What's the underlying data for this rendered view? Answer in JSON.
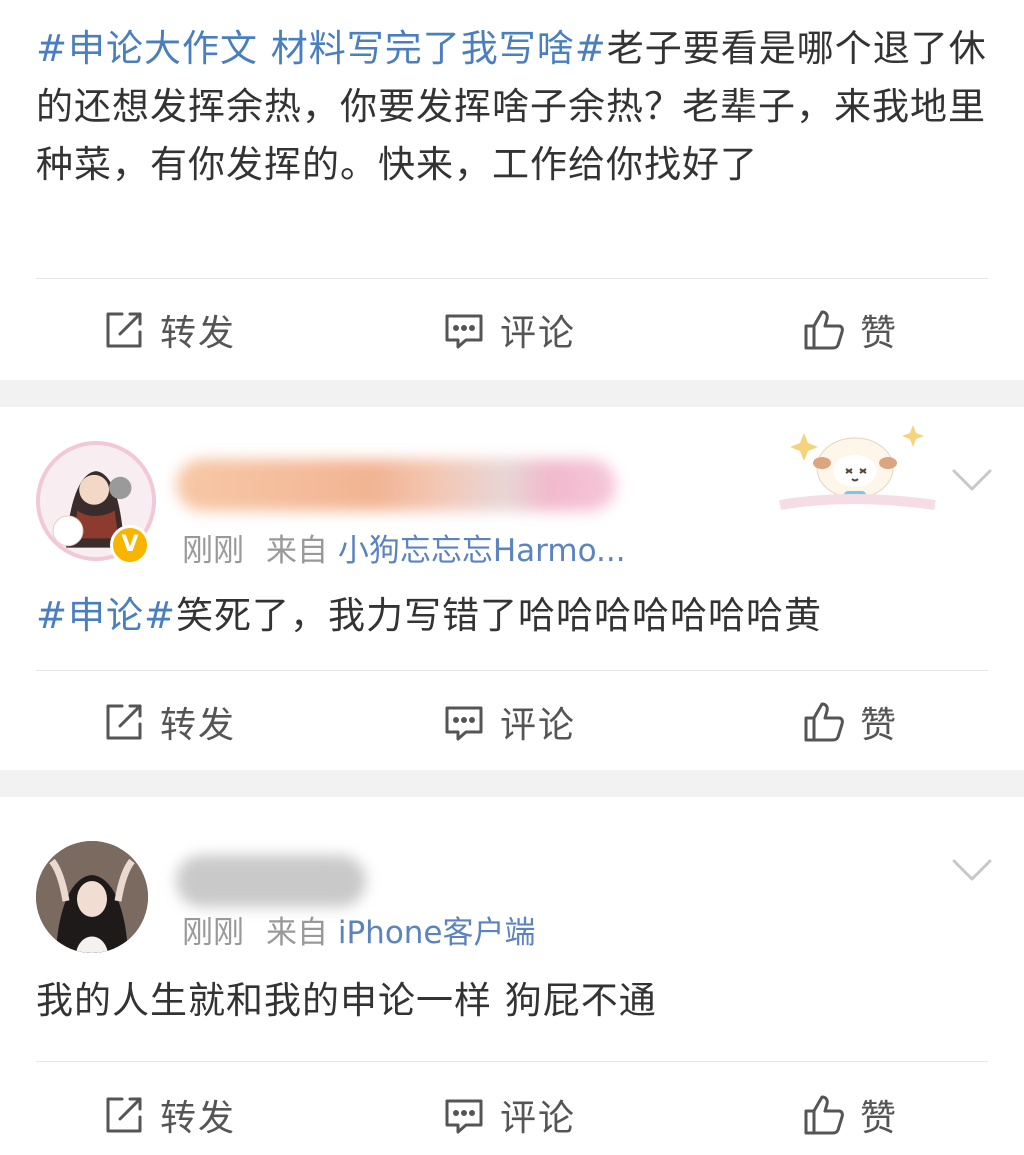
{
  "posts": [
    {
      "topic": "#申论大作文 材料写完了我写啥#",
      "text": "老子要看是哪个退了休的还想发挥余热，你要发挥啥子余热？老辈子，来我地里种菜，有你发挥的。快来，工作给你找好了",
      "actions": {
        "repost": "转发",
        "comment": "评论",
        "like": "赞"
      }
    },
    {
      "time": "刚刚",
      "source_prefix": "来自",
      "source": "小狗忘忘忘Harmo...",
      "verified_mark": "V",
      "topic": "#申论#",
      "text": "笑死了，我力写错了哈哈哈哈哈哈哈黄",
      "actions": {
        "repost": "转发",
        "comment": "评论",
        "like": "赞"
      }
    },
    {
      "time": "刚刚",
      "source_prefix": "来自",
      "source": "iPhone客户端",
      "text": "我的人生就和我的申论一样 狗屁不通",
      "actions": {
        "repost": "转发",
        "comment": "评论",
        "like": "赞"
      }
    }
  ],
  "colors": {
    "topic": "#4a7fbf",
    "source_link": "#5a83c0",
    "meta_gray": "#999999",
    "separator": "#f2f2f2",
    "verified": "#f7b500"
  },
  "icons": {
    "repost": "edit-share-icon",
    "comment": "comment-bubble-icon",
    "like": "thumbs-up-icon",
    "more": "chevron-down-icon"
  }
}
